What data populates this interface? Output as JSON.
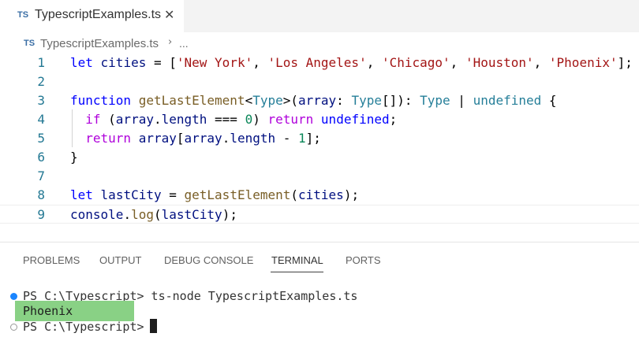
{
  "tab": {
    "badge": "TS",
    "filename": "TypescriptExamples.ts",
    "close": "✕"
  },
  "breadcrumb": {
    "badge": "TS",
    "file": "TypescriptExamples.ts",
    "separator": "›",
    "more": "..."
  },
  "editor": {
    "line_numbers": [
      "1",
      "2",
      "3",
      "4",
      "5",
      "6",
      "7",
      "8",
      "9"
    ],
    "current_line": 9,
    "lines": [
      [
        {
          "t": "let",
          "c": "kw"
        },
        {
          "t": " cities ",
          "c": "var"
        },
        {
          "t": "= [",
          "c": "op"
        },
        {
          "t": "'New York'",
          "c": "str"
        },
        {
          "t": ", ",
          "c": "op"
        },
        {
          "t": "'Los Angeles'",
          "c": "str"
        },
        {
          "t": ", ",
          "c": "op"
        },
        {
          "t": "'Chicago'",
          "c": "str"
        },
        {
          "t": ", ",
          "c": "op"
        },
        {
          "t": "'Houston'",
          "c": "str"
        },
        {
          "t": ", ",
          "c": "op"
        },
        {
          "t": "'Phoenix'",
          "c": "str"
        },
        {
          "t": "];",
          "c": "op"
        }
      ],
      [],
      [
        {
          "t": "function",
          "c": "kw"
        },
        {
          "t": " ",
          "c": "op"
        },
        {
          "t": "getLastElement",
          "c": "fn"
        },
        {
          "t": "<",
          "c": "op"
        },
        {
          "t": "Type",
          "c": "typ"
        },
        {
          "t": ">(",
          "c": "op"
        },
        {
          "t": "array",
          "c": "var"
        },
        {
          "t": ": ",
          "c": "op"
        },
        {
          "t": "Type",
          "c": "typ"
        },
        {
          "t": "[]): ",
          "c": "op"
        },
        {
          "t": "Type",
          "c": "typ"
        },
        {
          "t": " | ",
          "c": "op"
        },
        {
          "t": "undefined",
          "c": "typ"
        },
        {
          "t": " {",
          "c": "op"
        }
      ],
      [
        {
          "t": "  ",
          "c": "op"
        },
        {
          "t": "if",
          "c": "ctl"
        },
        {
          "t": " (",
          "c": "op"
        },
        {
          "t": "array",
          "c": "var"
        },
        {
          "t": ".",
          "c": "op"
        },
        {
          "t": "length",
          "c": "var"
        },
        {
          "t": " === ",
          "c": "op"
        },
        {
          "t": "0",
          "c": "num"
        },
        {
          "t": ") ",
          "c": "op"
        },
        {
          "t": "return",
          "c": "ctl"
        },
        {
          "t": " ",
          "c": "op"
        },
        {
          "t": "undefined",
          "c": "kw"
        },
        {
          "t": ";",
          "c": "op"
        }
      ],
      [
        {
          "t": "  ",
          "c": "op"
        },
        {
          "t": "return",
          "c": "ctl"
        },
        {
          "t": " ",
          "c": "op"
        },
        {
          "t": "array",
          "c": "var"
        },
        {
          "t": "[",
          "c": "op"
        },
        {
          "t": "array",
          "c": "var"
        },
        {
          "t": ".",
          "c": "op"
        },
        {
          "t": "length",
          "c": "var"
        },
        {
          "t": " - ",
          "c": "op"
        },
        {
          "t": "1",
          "c": "num"
        },
        {
          "t": "];",
          "c": "op"
        }
      ],
      [
        {
          "t": "}",
          "c": "op"
        }
      ],
      [],
      [
        {
          "t": "let",
          "c": "kw"
        },
        {
          "t": " ",
          "c": "op"
        },
        {
          "t": "lastCity",
          "c": "var"
        },
        {
          "t": " = ",
          "c": "op"
        },
        {
          "t": "getLastElement",
          "c": "fn"
        },
        {
          "t": "(",
          "c": "op"
        },
        {
          "t": "cities",
          "c": "var"
        },
        {
          "t": ");",
          "c": "op"
        }
      ],
      [
        {
          "t": "console",
          "c": "var"
        },
        {
          "t": ".",
          "c": "op"
        },
        {
          "t": "log",
          "c": "fn"
        },
        {
          "t": "(",
          "c": "op"
        },
        {
          "t": "lastCity",
          "c": "var"
        },
        {
          "t": ");",
          "c": "op"
        }
      ]
    ]
  },
  "panel": {
    "tabs": [
      "PROBLEMS",
      "OUTPUT",
      "DEBUG CONSOLE",
      "TERMINAL",
      "PORTS"
    ],
    "active_tab": "TERMINAL"
  },
  "terminal": {
    "line1": "PS C:\\Typescript> ts-node TypescriptExamples.ts",
    "output": "Phoenix",
    "line3": "PS C:\\Typescript> "
  },
  "colors": {
    "keyword": "#0000ff",
    "control": "#af00db",
    "string": "#a31515",
    "function": "#795e26",
    "variable": "#001080",
    "type": "#267f99",
    "number": "#098658",
    "line_number": "#237893",
    "output_highlight": "#89d185",
    "status_dot": "#1a85ff"
  }
}
